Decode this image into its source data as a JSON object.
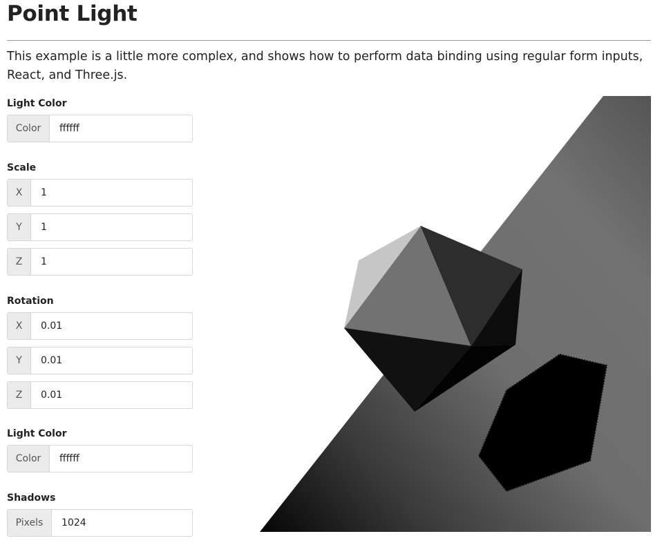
{
  "page": {
    "title": "Point Light",
    "intro": "This example is a little more complex, and shows how to perform data binding using regular form inputs, React, and Three.js."
  },
  "controls": {
    "light_color_1": {
      "label": "Light Color",
      "addon": "Color",
      "value": "ffffff"
    },
    "scale": {
      "label": "Scale",
      "x": {
        "addon": "X",
        "value": "1"
      },
      "y": {
        "addon": "Y",
        "value": "1"
      },
      "z": {
        "addon": "Z",
        "value": "1"
      }
    },
    "rotation": {
      "label": "Rotation",
      "x": {
        "addon": "X",
        "value": "0.01"
      },
      "y": {
        "addon": "Y",
        "value": "0.01"
      },
      "z": {
        "addon": "Z",
        "value": "0.01"
      }
    },
    "light_color_2": {
      "label": "Light Color",
      "addon": "Color",
      "value": "ffffff"
    },
    "shadows": {
      "label": "Shadows",
      "addon": "Pixels",
      "value": "1024"
    }
  }
}
